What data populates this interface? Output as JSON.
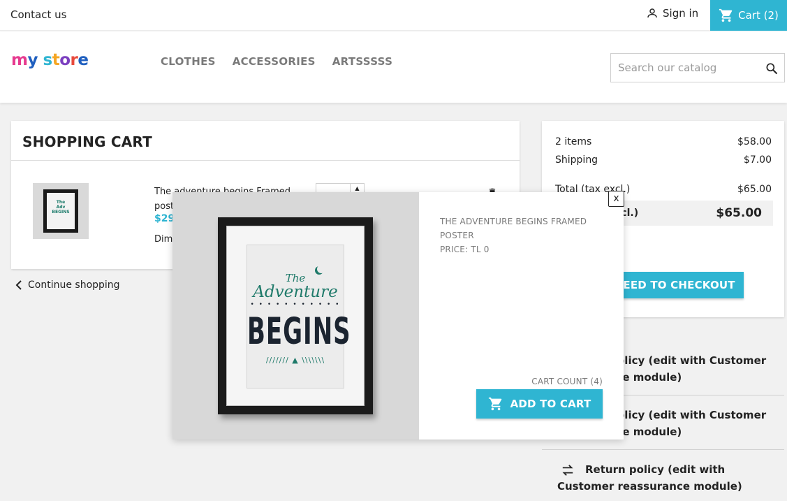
{
  "topbar": {
    "contact_label": "Contact us",
    "signin_label": "Sign in",
    "cart_label": "Cart (2)"
  },
  "header": {
    "logo_text": "my store",
    "nav": [
      "CLOTHES",
      "ACCESSORIES",
      "ARTSSSSS"
    ],
    "search_placeholder": "Search our catalog"
  },
  "cart": {
    "title": "SHOPPING CART",
    "product_name": "The adventure begins Framed poster",
    "price": "$29",
    "dimension_label": "Dim",
    "continue_label": "Continue shopping"
  },
  "summary": {
    "items_label": "2 items",
    "items_value": "$58.00",
    "shipping_label": "Shipping",
    "shipping_value": "$7.00",
    "total_excl_label": "Total (tax excl.)",
    "total_excl_value": "$65.00",
    "total_incl_label": "Total (tax incl.)",
    "total_incl_value": "$65.00",
    "checkout_label": "PROCEED TO CHECKOUT"
  },
  "reassurance": [
    "Security policy (edit with Customer reassurance module)",
    "Delivery policy (edit with Customer reassurance module)",
    "Return policy (edit with Customer reassurance module)"
  ],
  "popup": {
    "close_label": "x",
    "title": "THE ADVENTURE BEGINS FRAMED POSTER",
    "price_label": "PRICE: TL 0",
    "cart_count": "CART COUNT (4)",
    "add_to_cart_label": "ADD TO CART",
    "poster_text": {
      "the": "The",
      "adventure": "Adventure",
      "begins": "BEGINS"
    }
  },
  "colors": {
    "accent": "#2fb5d2",
    "poster_green": "#1f7a6a"
  }
}
